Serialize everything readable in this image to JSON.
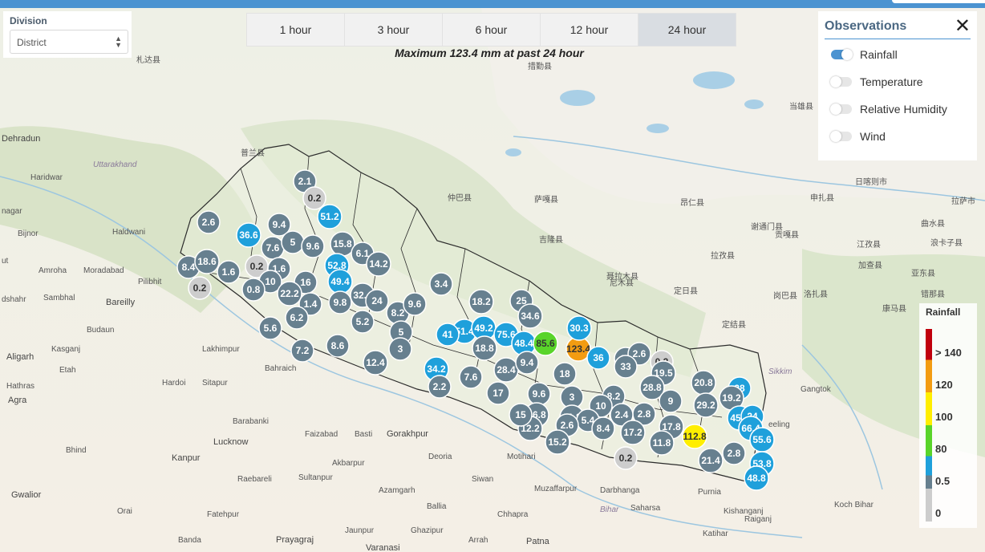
{
  "division": {
    "label": "Division",
    "selected": "District"
  },
  "time_tabs": [
    {
      "label": "1 hour",
      "active": false
    },
    {
      "label": "3 hour",
      "active": false
    },
    {
      "label": "6 hour",
      "active": false
    },
    {
      "label": "12 hour",
      "active": false
    },
    {
      "label": "24 hour",
      "active": true
    }
  ],
  "max_text": "Maximum 123.4 mm at past 24 hour",
  "observations": {
    "title": "Observations",
    "close_icon": "close-icon",
    "items": [
      {
        "label": "Rainfall",
        "on": true
      },
      {
        "label": "Temperature",
        "on": false
      },
      {
        "label": "Relative Humidity",
        "on": false
      },
      {
        "label": "Wind",
        "on": false
      }
    ]
  },
  "legend": {
    "title": "Rainfall",
    "ticks": [
      "> 140",
      "120",
      "100",
      "80",
      "0.5",
      "0"
    ],
    "colors": {
      "gt140": "#c0000c",
      "c120": "#f39c12",
      "c100": "#ffee00",
      "c80": "#59d42a",
      "c05": "#1fa0db",
      "c_low": "#67808f",
      "c0": "#cdcdcd"
    }
  },
  "map_labels": {
    "uttarakhand": "Uttarakhand",
    "dehradun": "Dehradun",
    "haridwar": "Haridwar",
    "nagar": "nagar",
    "bijnor": "Bijnor",
    "haldwani": "Haldwani",
    "amroha": "Amroha",
    "moradabad": "Moradabad",
    "pilibhit": "Pilibhit",
    "sambhal": "Sambhal",
    "bareilly": "Bareilly",
    "budaun": "Budaun",
    "shahr": "dshahr",
    "aligarh": "Aligarh",
    "kasganj": "Kasganj",
    "etah": "Etah",
    "lakhimpur": "Lakhimpur",
    "bahraich": "Bahraich",
    "hathras": "Hathras",
    "hardoi": "Hardoi",
    "sitapur": "Sitapur",
    "agra": "Agra",
    "barabanki": "Barabanki",
    "faizabad": "Faizabad",
    "basti": "Basti",
    "gorakhpur": "Gorakhpur",
    "lucknow": "Lucknow",
    "bhind": "Bhind",
    "kanpur": "Kanpur",
    "akbarpur": "Akbarpur",
    "deoria": "Deoria",
    "motihari": "Motihari",
    "raebareli": "Raebareli",
    "sultanpur": "Sultanpur",
    "azamgarh": "Azamgarh",
    "siwan": "Siwan",
    "muzaffarpur": "Muzaffarpur",
    "darbhanga": "Darbhanga",
    "gwalior": "Gwalior",
    "orai": "Orai",
    "fatehpur": "Fatehpur",
    "ballia": "Ballia",
    "chhapra": "Chhapra",
    "saharsa": "Saharsa",
    "bihar": "Bihar",
    "purnia": "Purnia",
    "prayagraj": "Prayagraj",
    "jaunpur": "Jaunpur",
    "ghazipur": "Ghazipur",
    "banda": "Banda",
    "varanasi": "Varanasi",
    "arrah": "Arrah",
    "patna": "Patna",
    "katihar": "Katihar",
    "raiganj": "Raiganj",
    "kishanganj": "Kishanganj",
    "sikkim": "Sikkim",
    "gangtok": "Gangtok",
    "kochbihar": "Koch Bihar",
    "siliguri": "eeling",
    "ut": "ut",
    "zhongba": "仲巴县",
    "saga": "萨嘎县",
    "jilong": "吉隆县",
    "nielamu": "聂拉木县",
    "dingri": "定日县",
    "angren": "昂仁县",
    "xietongmen": "谢通门县",
    "lazi": "拉孜县",
    "jiangzi": "江孜县",
    "kangma": "康马县",
    "yadong": "亚东县",
    "gangba": "岗巴县",
    "dingjie": "定结县",
    "rikaze": "日喀则市",
    "lhunzhub": "拉萨市",
    "qushui": "曲水县",
    "jiacha": "加查县",
    "langkazi": "浪卡子县",
    "gongga": "贡嘎县",
    "shenzha": "申扎县",
    "cuoqin": "措勤县",
    "zhada": "札达县",
    "pulan": "普兰县",
    "luozha": "洛扎县",
    "cuona": "错那县",
    "kangbao": "康马县",
    "dangxiong": "当雄县",
    "nimu": "尼木县"
  },
  "stations": [
    {
      "v": "2.1",
      "c": "grey"
    },
    {
      "v": "0.2",
      "c": "light"
    },
    {
      "v": "51.2",
      "c": "blue"
    },
    {
      "v": "2.6",
      "c": "grey"
    },
    {
      "v": "9.4",
      "c": "grey"
    },
    {
      "v": "36.6",
      "c": "blue"
    },
    {
      "v": "7.6",
      "c": "grey"
    },
    {
      "v": "5",
      "c": "grey"
    },
    {
      "v": "9.6",
      "c": "grey"
    },
    {
      "v": "15.8",
      "c": "grey"
    },
    {
      "v": "6.1",
      "c": "grey"
    },
    {
      "v": "14.2",
      "c": "grey"
    },
    {
      "v": "8.4",
      "c": "grey"
    },
    {
      "v": "18.6",
      "c": "grey"
    },
    {
      "v": "1.6",
      "c": "grey"
    },
    {
      "v": "0.2",
      "c": "light"
    },
    {
      "v": "1.6",
      "c": "grey"
    },
    {
      "v": "52.8",
      "c": "blue"
    },
    {
      "v": "0.2",
      "c": "light"
    },
    {
      "v": "10",
      "c": "grey"
    },
    {
      "v": "16",
      "c": "grey"
    },
    {
      "v": "49.4",
      "c": "blue"
    },
    {
      "v": "0.8",
      "c": "grey"
    },
    {
      "v": "22.2",
      "c": "grey"
    },
    {
      "v": "32.4",
      "c": "grey"
    },
    {
      "v": "24",
      "c": "grey"
    },
    {
      "v": "3.4",
      "c": "grey"
    },
    {
      "v": "9.8",
      "c": "grey"
    },
    {
      "v": "1.4",
      "c": "grey"
    },
    {
      "v": "6.2",
      "c": "grey"
    },
    {
      "v": "5.6",
      "c": "grey"
    },
    {
      "v": "8.2",
      "c": "grey"
    },
    {
      "v": "9.6",
      "c": "grey"
    },
    {
      "v": "5.2",
      "c": "grey"
    },
    {
      "v": "18.2",
      "c": "grey"
    },
    {
      "v": "25",
      "c": "grey"
    },
    {
      "v": "34.6",
      "c": "grey"
    },
    {
      "v": "5",
      "c": "grey"
    },
    {
      "v": "51.4",
      "c": "blue"
    },
    {
      "v": "49.2",
      "c": "blue"
    },
    {
      "v": "75.6",
      "c": "blue"
    },
    {
      "v": "41",
      "c": "blue"
    },
    {
      "v": "7.2",
      "c": "grey"
    },
    {
      "v": "8.6",
      "c": "grey"
    },
    {
      "v": "18.8",
      "c": "grey"
    },
    {
      "v": "48.4",
      "c": "blue"
    },
    {
      "v": "85.6",
      "c": "green"
    },
    {
      "v": "123.4",
      "c": "orange"
    },
    {
      "v": "30.3",
      "c": "blue"
    },
    {
      "v": "3",
      "c": "grey"
    },
    {
      "v": "12.4",
      "c": "grey"
    },
    {
      "v": "34.2",
      "c": "blue"
    },
    {
      "v": "7.6",
      "c": "grey"
    },
    {
      "v": "28.4",
      "c": "grey"
    },
    {
      "v": "9.4",
      "c": "grey"
    },
    {
      "v": "18",
      "c": "grey"
    },
    {
      "v": "36",
      "c": "blue"
    },
    {
      "v": "27",
      "c": "grey"
    },
    {
      "v": "2.6",
      "c": "grey"
    },
    {
      "v": "33",
      "c": "grey"
    },
    {
      "v": "0.2",
      "c": "light"
    },
    {
      "v": "19.5",
      "c": "grey"
    },
    {
      "v": "2.2",
      "c": "grey"
    },
    {
      "v": "17",
      "c": "grey"
    },
    {
      "v": "9.6",
      "c": "grey"
    },
    {
      "v": "3",
      "c": "grey"
    },
    {
      "v": "28.8",
      "c": "grey"
    },
    {
      "v": "9",
      "c": "grey"
    },
    {
      "v": "20.8",
      "c": "grey"
    },
    {
      "v": "38",
      "c": "blue"
    },
    {
      "v": "16.8",
      "c": "grey"
    },
    {
      "v": "21.8",
      "c": "grey"
    },
    {
      "v": "8.2",
      "c": "grey"
    },
    {
      "v": "10",
      "c": "grey"
    },
    {
      "v": "2.8",
      "c": "grey"
    },
    {
      "v": "29.2",
      "c": "grey"
    },
    {
      "v": "12.2",
      "c": "grey"
    },
    {
      "v": "15",
      "c": "grey"
    },
    {
      "v": "19.2",
      "c": "grey"
    },
    {
      "v": "5.4",
      "c": "grey"
    },
    {
      "v": "2.4",
      "c": "grey"
    },
    {
      "v": "17.8",
      "c": "grey"
    },
    {
      "v": "45.8",
      "c": "blue"
    },
    {
      "v": "24",
      "c": "blue"
    },
    {
      "v": "6.6",
      "c": "grey"
    },
    {
      "v": "8.4",
      "c": "grey"
    },
    {
      "v": "17.2",
      "c": "grey"
    },
    {
      "v": "112.8",
      "c": "yellow"
    },
    {
      "v": "66.4",
      "c": "blue"
    },
    {
      "v": "55.6",
      "c": "blue"
    },
    {
      "v": "0.2",
      "c": "light"
    },
    {
      "v": "11.8",
      "c": "grey"
    },
    {
      "v": "21.4",
      "c": "grey"
    },
    {
      "v": "2.8",
      "c": "grey"
    },
    {
      "v": "53.8",
      "c": "blue"
    },
    {
      "v": "48.8",
      "c": "blue"
    },
    {
      "v": "2.6",
      "c": "grey"
    },
    {
      "v": "15.2",
      "c": "grey"
    },
    {
      "v": "6.4",
      "c": "grey"
    }
  ]
}
